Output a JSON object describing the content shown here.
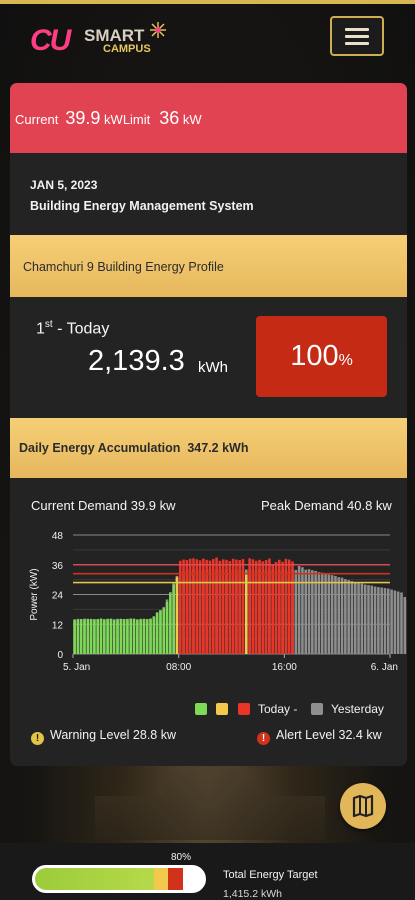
{
  "header": {
    "logo_cu": "CU",
    "logo_smart": "SMART",
    "logo_campus": "CAMPUS"
  },
  "current": {
    "label": "Current",
    "value": "39.9",
    "unit": "kW",
    "limit_label": "Limit",
    "limit_value": "36",
    "limit_unit": "kW",
    "bar_color": "#e24353"
  },
  "info": {
    "date": "JAN 5, 2023",
    "system": "Building Energy Management System"
  },
  "profile": {
    "title": "Chamchuri 9 Building Energy Profile"
  },
  "today": {
    "rank": "1",
    "rank_suffix": "st",
    "rank_label": " - Today",
    "energy": "2,139.3",
    "energy_unit": "kWh",
    "percent": "100",
    "percent_sign": "%",
    "percent_color": "#c52a14"
  },
  "daily": {
    "label": "Daily Energy Accumulation",
    "value": "347.2 kWh"
  },
  "demand": {
    "current_label": "Current  Demand 39.9  kw",
    "peak_label": "Peak Demand 40.8  kw"
  },
  "chart_data": {
    "type": "bar",
    "ylabel": "Power (kW)",
    "xlabel": "",
    "ylim": [
      0,
      48
    ],
    "yticks": [
      0,
      12,
      24,
      36,
      48
    ],
    "yticks_extra": [
      6,
      18,
      30,
      42
    ],
    "xtick_labels": [
      "5. Jan",
      "08:00",
      "16:00",
      "6. Jan"
    ],
    "xtick_hours": [
      0,
      8,
      16,
      24
    ],
    "x_unit_hint": "hour of day",
    "legend": [
      "Today -",
      "Yesterday"
    ],
    "reference_lines": [
      {
        "name": "Warning Level",
        "value": 28.8,
        "color": "#e2c544"
      },
      {
        "name": "Alert Level",
        "value": 32.4,
        "color": "#d0321c"
      },
      {
        "name": "Limit",
        "value": 36,
        "color": "#d94a55"
      }
    ],
    "series": [
      {
        "name": "Today -",
        "colors": {
          "normal": "#7ed957",
          "warning": "#f2c94c",
          "alert": "#ec3426"
        },
        "x_start": 0,
        "x_step": 0.25,
        "values": [
          13.8,
          13.9,
          14.1,
          14.0,
          14.2,
          14.0,
          13.9,
          14.1,
          14.3,
          14.0,
          14.2,
          14.1,
          13.9,
          14.0,
          14.2,
          14.1,
          14.0,
          14.3,
          14.1,
          13.9,
          14.0,
          14.2,
          14.1,
          14.3,
          15.2,
          16.8,
          17.5,
          18.4,
          21.0,
          24.5,
          28.0,
          31.0,
          37.6,
          38.1,
          37.9,
          38.4,
          38.6,
          38.2,
          37.8,
          38.5,
          38.0,
          37.7,
          38.3,
          38.9,
          37.6,
          38.2,
          38.0,
          37.5,
          38.4,
          38.1,
          37.9,
          38.3,
          32.8,
          38.6,
          38.2,
          37.6,
          38.0,
          37.4,
          37.9,
          38.5,
          36.2,
          37.1,
          38.0,
          37.2,
          38.4,
          38.1,
          37.3
        ]
      },
      {
        "name": "Yesterday",
        "color": "#8e8e8e",
        "x_start": 0,
        "x_step": 0.25,
        "values": [
          14.0,
          14.2,
          14.1,
          14.3,
          14.0,
          14.2,
          14.1,
          13.9,
          14.2,
          14.0,
          14.1,
          14.3,
          14.0,
          14.2,
          14.1,
          14.0,
          14.2,
          14.1,
          14.3,
          14.0,
          14.2,
          14.1,
          14.0,
          14.2,
          15.0,
          16.5,
          17.8,
          19.0,
          22.0,
          25.0,
          28.5,
          31.5,
          33.0,
          33.5,
          34.0,
          33.8,
          34.2,
          34.5,
          34.0,
          33.7,
          34.1,
          34.3,
          34.0,
          33.9,
          34.2,
          34.4,
          33.8,
          34.1,
          34.0,
          33.6,
          34.2,
          33.9,
          34.1,
          34.3,
          33.8,
          34.0,
          34.2,
          33.7,
          34.1,
          33.9,
          34.0,
          34.2,
          33.8,
          34.1,
          34.0,
          33.6,
          34.3,
          33.9,
          35.5,
          35.0,
          34.0,
          34.2,
          33.8,
          33.5,
          33.0,
          32.8,
          32.4,
          32.0,
          31.8,
          31.5,
          31.0,
          30.8,
          30.2,
          29.8,
          29.4,
          29.0,
          28.6,
          28.4,
          28.0,
          27.8,
          27.6,
          27.2,
          27.0,
          26.8,
          26.6,
          26.4,
          26.0,
          25.6,
          25.2,
          24.8,
          23.0,
          21.5,
          20.0,
          18.5,
          17.0,
          16.0,
          15.5,
          15.2,
          15.0,
          14.8,
          14.6,
          14.4,
          14.6,
          14.8,
          14.5,
          14.3,
          14.6,
          14.4,
          14.2,
          14.5,
          14.3,
          14.6,
          14.4,
          14.2,
          14.5,
          14.3,
          14.6,
          14.4,
          14.2,
          14.5,
          14.3,
          14.6,
          14.4,
          14.5,
          14.3,
          14.4,
          14.5,
          14.3,
          14.4,
          14.6
        ]
      }
    ]
  },
  "levels": {
    "warning_label": "Warning Level 28.8  kw",
    "alert_label": "Alert Level 32.4  kw",
    "warning_color": "#e2c544",
    "alert_color": "#d0321c"
  },
  "icons": {
    "menu": "hamburger-menu-icon",
    "map": "map-icon",
    "warning": "warning-icon",
    "alert": "alert-icon"
  },
  "footer": {
    "percent": "80%",
    "target_title": "Total Energy Target",
    "target_value": "1,415.2 kWh",
    "progress_fraction": 0.8
  }
}
